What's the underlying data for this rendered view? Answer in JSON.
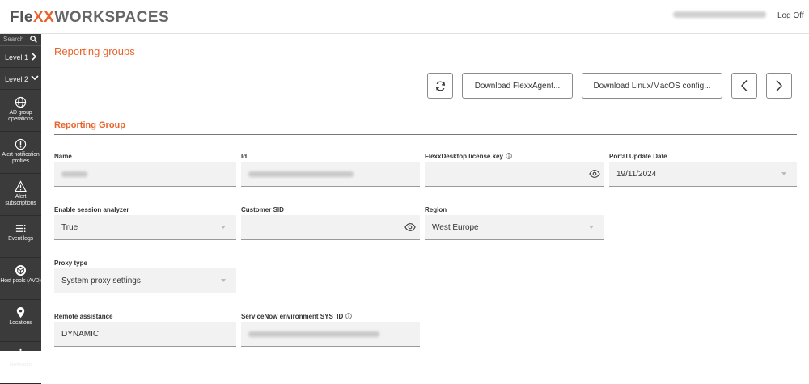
{
  "header": {
    "logo_prefix": "Fle",
    "logo_xx": "XX",
    "logo_suffix": "WORKSPACES",
    "logoff_label": "Log Off"
  },
  "sidebar": {
    "search_placeholder": "Search",
    "levels": [
      {
        "label": "Level 1",
        "icon": "chevron-right-icon"
      },
      {
        "label": "Level 2",
        "icon": "chevron-down-icon"
      }
    ],
    "items": [
      {
        "label_line1": "AD group",
        "label_line2": "operations",
        "icon": "globe-icon"
      },
      {
        "label_line1": "Alert notification",
        "label_line2": "profiles",
        "icon": "alert-circle-icon"
      },
      {
        "label_line1": "Alert",
        "label_line2": "subscriptions",
        "icon": "warning-icon"
      },
      {
        "label_line1": "Event logs",
        "label_line2": "",
        "icon": "list-icon"
      },
      {
        "label_line1": "Host pools (AVD)",
        "label_line2": "",
        "icon": "cube-icon"
      },
      {
        "label_line1": "Locations",
        "label_line2": "",
        "icon": "location-pin-icon"
      },
      {
        "label_line1": "Networks",
        "label_line2": "",
        "icon": "network-icon"
      }
    ]
  },
  "main": {
    "page_title": "Reporting groups",
    "toolbar": {
      "refresh_icon": "refresh-icon",
      "download_flexx_label": "Download FlexxAgent...",
      "download_linux_label": "Download Linux/MacOS config...",
      "prev_icon": "chevron-left-icon",
      "next_icon": "chevron-right-icon"
    },
    "section_title": "Reporting Group",
    "fields": {
      "name": {
        "label": "Name",
        "value": ""
      },
      "id": {
        "label": "Id",
        "value": ""
      },
      "license_key": {
        "label": "FlexxDesktop license key",
        "value": ""
      },
      "portal_update_date": {
        "label": "Portal Update Date",
        "value": "19/11/2024"
      },
      "session_analyzer": {
        "label": "Enable session analyzer",
        "value": "True"
      },
      "customer_sid": {
        "label": "Customer SID",
        "value": ""
      },
      "region": {
        "label": "Region",
        "value": "West Europe"
      },
      "proxy_type": {
        "label": "Proxy type",
        "value": "System proxy settings"
      },
      "remote_assistance": {
        "label": "Remote assistance",
        "value": "DYNAMIC"
      },
      "servicenow_sys_id": {
        "label": "ServiceNow environment SYS_ID",
        "value": ""
      }
    }
  },
  "colors": {
    "accent": "#e8632b",
    "sidebar_bg": "#3b3b3b",
    "field_bg": "#f2f2f2"
  }
}
